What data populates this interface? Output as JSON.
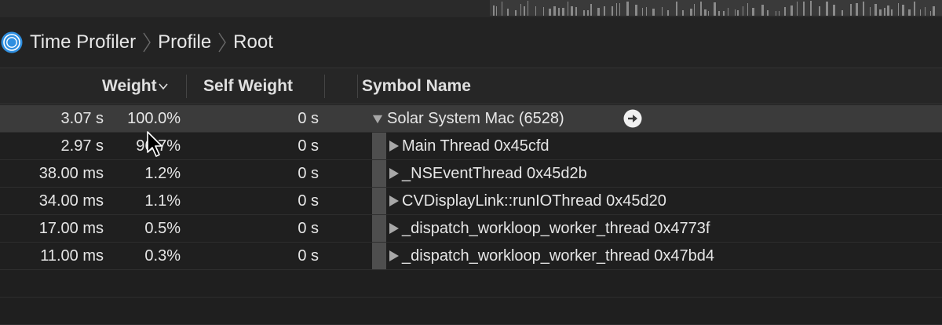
{
  "colors": {
    "background": "#1e1e1e",
    "selected_row": "#3b3b3b",
    "icon_blue": "#2f8fe0",
    "text": "#e6e6e6"
  },
  "breadcrumb": {
    "icon": "time-profiler-icon",
    "items": [
      "Time Profiler",
      "Profile",
      "Root"
    ]
  },
  "columns": {
    "weight": "Weight",
    "self_weight": "Self Weight",
    "symbol_name": "Symbol Name"
  },
  "rows": [
    {
      "time": "3.07 s",
      "percent": "100.0%",
      "self": "0 s",
      "symbol": "Solar System Mac (6528)",
      "expanded": true,
      "selected": true
    },
    {
      "time": "2.97 s",
      "percent": "96.7%",
      "self": "0 s",
      "symbol": "Main Thread  0x45cfd",
      "expanded": false,
      "selected": false
    },
    {
      "time": "38.00 ms",
      "percent": "1.2%",
      "self": "0 s",
      "symbol": "_NSEventThread  0x45d2b",
      "expanded": false,
      "selected": false
    },
    {
      "time": "34.00 ms",
      "percent": "1.1%",
      "self": "0 s",
      "symbol": "CVDisplayLink::runIOThread  0x45d20",
      "expanded": false,
      "selected": false
    },
    {
      "time": "17.00 ms",
      "percent": "0.5%",
      "self": "0 s",
      "symbol": "_dispatch_workloop_worker_thread  0x4773f",
      "expanded": false,
      "selected": false
    },
    {
      "time": "11.00 ms",
      "percent": "0.3%",
      "self": "0 s",
      "symbol": "_dispatch_workloop_worker_thread  0x47bd4",
      "expanded": false,
      "selected": false
    }
  ]
}
